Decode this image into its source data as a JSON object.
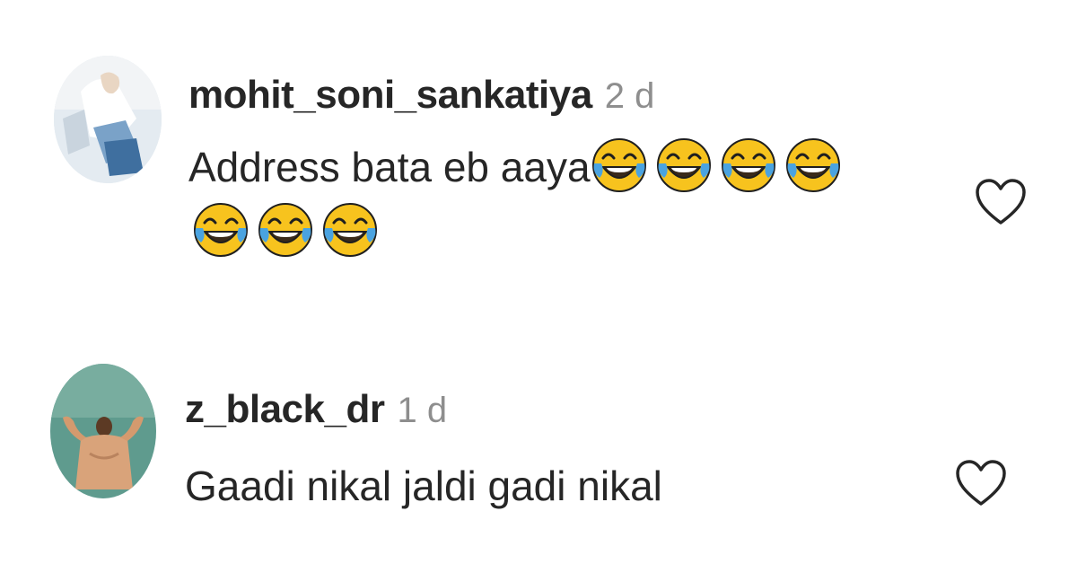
{
  "comments": [
    {
      "username": "mohit_soni_sankatiya",
      "time": "2 d",
      "text": "Address bata eb aaya",
      "emoji_name": "face-with-tears-of-joy-icon",
      "emoji_count_line1": 4,
      "emoji_count_line2": 3,
      "like_icon": "heart-outline-icon"
    },
    {
      "username": "z_black_dr",
      "time": "1 d",
      "text": "Gaadi nikal jaldi gadi nikal",
      "like_icon": "heart-outline-icon"
    }
  ],
  "colors": {
    "username": "#262626",
    "timestamp": "#8e8e8e",
    "emoji_face": "#f7c31e",
    "emoji_tears": "#4aa3e0"
  }
}
